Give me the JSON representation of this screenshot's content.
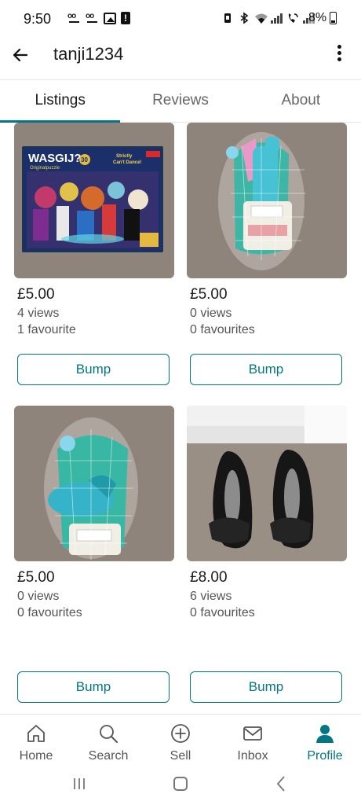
{
  "status_bar": {
    "time": "9:50",
    "battery": "8%",
    "left_icons": [
      "voicemail-icon",
      "voicemail-icon",
      "image-icon",
      "alert-icon"
    ],
    "right_icons": [
      "battery-saver-icon",
      "bluetooth-icon",
      "wifi-icon",
      "signal-icon",
      "wifi-calling-icon",
      "signal-icon"
    ]
  },
  "header": {
    "back_icon": "arrow-left-icon",
    "username": "tanji1234",
    "more_icon": "more-vertical-icon"
  },
  "tabs": [
    {
      "label": "Listings",
      "active": true
    },
    {
      "label": "Reviews",
      "active": false
    },
    {
      "label": "About",
      "active": false
    }
  ],
  "listings": [
    {
      "price": "£5.00",
      "views": "4 views",
      "favourites": "1 favourite",
      "bump_label": "Bump"
    },
    {
      "price": "£5.00",
      "views": "0 views",
      "favourites": "0 favourites",
      "bump_label": "Bump"
    },
    {
      "price": "£5.00",
      "views": "0 views",
      "favourites": "0 favourites",
      "bump_label": "Bump"
    },
    {
      "price": "£8.00",
      "views": "6 views",
      "favourites": "0 favourites",
      "bump_label": "Bump"
    }
  ],
  "puzzle_box": {
    "brand": "WASGIJ?",
    "subtitle": "Originalpuzzle",
    "number": "30",
    "title_line1": "Strictly",
    "title_line2": "Can't Dance!"
  },
  "bottom_nav": [
    {
      "label": "Home",
      "icon": "home-icon",
      "active": false
    },
    {
      "label": "Search",
      "icon": "search-icon",
      "active": false
    },
    {
      "label": "Sell",
      "icon": "plus-circle-icon",
      "active": false
    },
    {
      "label": "Inbox",
      "icon": "mail-icon",
      "active": false
    },
    {
      "label": "Profile",
      "icon": "person-icon",
      "active": true
    }
  ],
  "colors": {
    "accent": "#007782",
    "carpet": "#8e8279",
    "text": "#1a1a1a",
    "muted": "#555555"
  }
}
